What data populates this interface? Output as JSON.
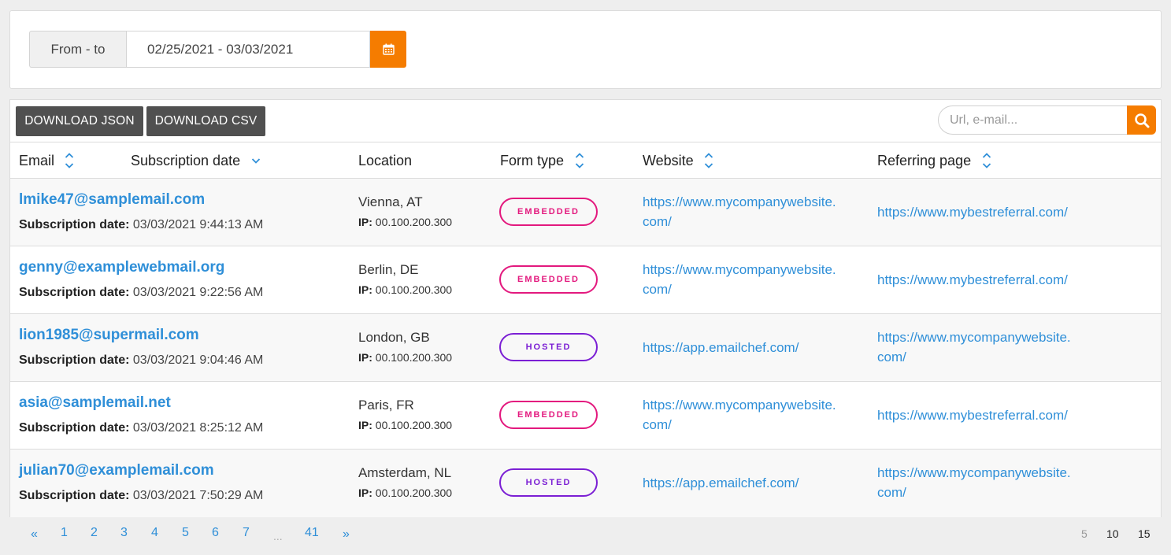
{
  "filter": {
    "label": "From - to",
    "date_range": "02/25/2021 - 03/03/2021",
    "calendar_icon": "calendar-icon",
    "accent_color": "#f57c00"
  },
  "toolbar": {
    "download_json": "DOWNLOAD JSON",
    "download_csv": "DOWNLOAD CSV",
    "search_placeholder": "Url, e-mail...",
    "search_icon": "search-icon"
  },
  "columns": {
    "email": "Email",
    "subscription_date": "Subscription date",
    "location": "Location",
    "form_type": "Form type",
    "website": "Website",
    "referring_page": "Referring page"
  },
  "row_labels": {
    "subscription_date": "Subscription date:",
    "ip": "IP:"
  },
  "rows": [
    {
      "email": "lmike47@samplemail.com",
      "date": "03/03/2021 9:44:13 AM",
      "city": "Vienna, AT",
      "ip": "00.100.200.300",
      "form_type": "EMBEDDED",
      "website_1": "https://www.mycompanywebsite.",
      "website_2": "com/",
      "referring_1": "https://www.mybestreferral.com/",
      "referring_2": ""
    },
    {
      "email": "genny@examplewebmail.org",
      "date": "03/03/2021 9:22:56 AM",
      "city": "Berlin, DE",
      "ip": "00.100.200.300",
      "form_type": "EMBEDDED",
      "website_1": "https://www.mycompanywebsite.",
      "website_2": "com/",
      "referring_1": "https://www.mybestreferral.com/",
      "referring_2": ""
    },
    {
      "email": "lion1985@supermail.com",
      "date": "03/03/2021 9:04:46 AM",
      "city": "London, GB",
      "ip": "00.100.200.300",
      "form_type": "HOSTED",
      "website_1": "https://app.emailchef.com/",
      "website_2": "",
      "referring_1": "https://www.mycompanywebsite.",
      "referring_2": "com/"
    },
    {
      "email": "asia@samplemail.net",
      "date": "03/03/2021 8:25:12 AM",
      "city": "Paris, FR",
      "ip": "00.100.200.300",
      "form_type": "EMBEDDED",
      "website_1": "https://www.mycompanywebsite.",
      "website_2": "com/",
      "referring_1": "https://www.mybestreferral.com/",
      "referring_2": ""
    },
    {
      "email": "julian70@examplemail.com",
      "date": "03/03/2021 7:50:29 AM",
      "city": "Amsterdam, NL",
      "ip": "00.100.200.300",
      "form_type": "HOSTED",
      "website_1": "https://app.emailchef.com/",
      "website_2": "",
      "referring_1": "https://www.mycompanywebsite.",
      "referring_2": "com/"
    }
  ],
  "colors": {
    "link": "#2f8fd8",
    "embedded": "#e3197e",
    "hosted": "#7b1fd4"
  },
  "pagination": {
    "prev": "«",
    "pages": [
      "1",
      "2",
      "3",
      "4",
      "5",
      "6",
      "7"
    ],
    "ellipsis": "...",
    "last": "41",
    "next": "»"
  },
  "per_page": [
    "5",
    "10",
    "15"
  ]
}
